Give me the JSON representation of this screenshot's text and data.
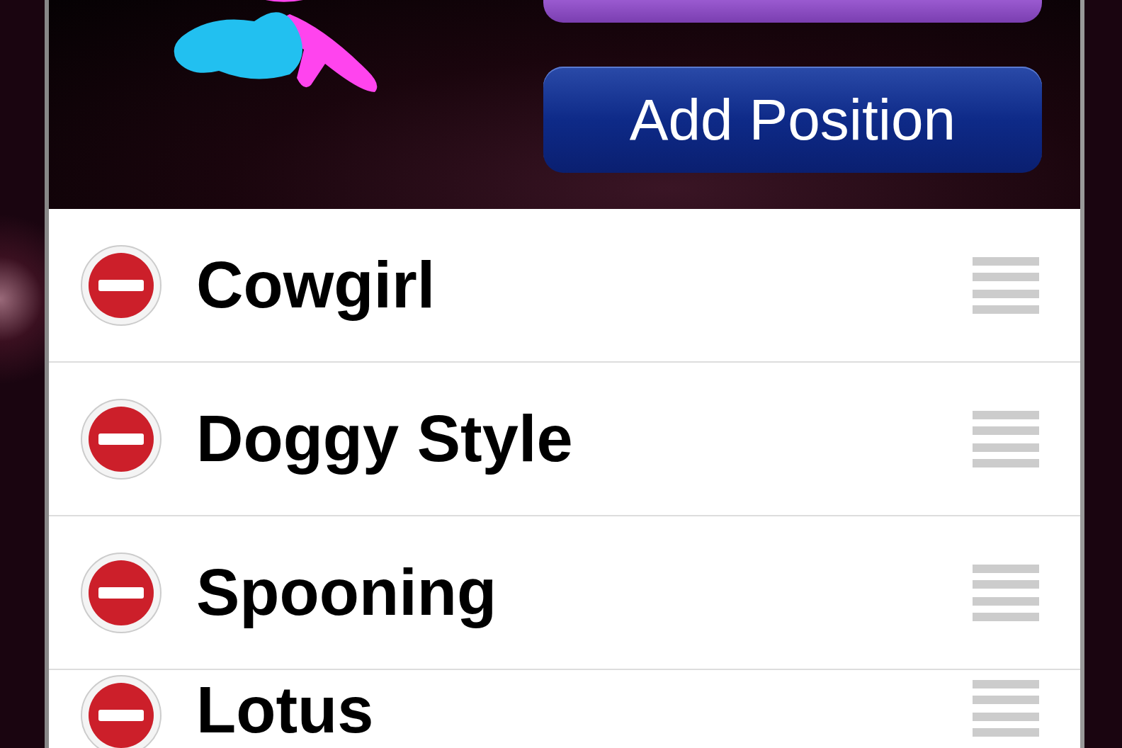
{
  "header": {
    "buttons": [
      {
        "kind": "plain"
      },
      {
        "kind": "add",
        "label": "Add Position"
      }
    ]
  },
  "list": {
    "editing": true,
    "rows": [
      {
        "name": "Cowgirl"
      },
      {
        "name": "Doggy Style"
      },
      {
        "name": "Spooning"
      },
      {
        "name": "Lotus"
      }
    ]
  }
}
